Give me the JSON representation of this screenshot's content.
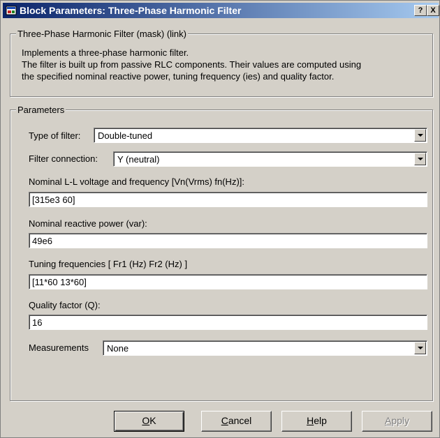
{
  "window": {
    "title": "Block Parameters: Three-Phase Harmonic Filter",
    "help_glyph": "?",
    "close_glyph": "X"
  },
  "mask_group": {
    "legend": "Three-Phase Harmonic Filter (mask) (link)",
    "lines": [
      "Implements a three-phase harmonic filter.",
      "The filter is built up from passive RLC components. Their values are computed using",
      "the specified  nominal reactive power, tuning frequency (ies) and quality factor."
    ]
  },
  "params_group": {
    "legend": "Parameters",
    "filter_type": {
      "label": "Type of filter:",
      "value": "Double-tuned"
    },
    "filter_connection": {
      "label": "Filter connection:",
      "value": "Y (neutral)"
    },
    "nominal_voltage": {
      "label": "Nominal L-L voltage and frequency  [Vn(Vrms) fn(Hz)]:",
      "value": "[315e3 60]"
    },
    "reactive_power": {
      "label": "Nominal reactive power (var):",
      "value": "49e6"
    },
    "tuning_freq": {
      "label": "Tuning frequencies [ Fr1 (Hz)   Fr2 (Hz) ]",
      "value": "[11*60 13*60]"
    },
    "quality_factor": {
      "label": "Quality factor (Q):",
      "value": "16"
    },
    "measurements": {
      "label": "Measurements",
      "value": "None"
    }
  },
  "buttons": {
    "ok": {
      "mnemonic": "O",
      "rest": "K"
    },
    "cancel": {
      "mnemonic": "C",
      "rest": "ancel"
    },
    "help": {
      "mnemonic": "H",
      "rest": "elp"
    },
    "apply": {
      "mnemonic": "A",
      "rest": "pply"
    }
  }
}
